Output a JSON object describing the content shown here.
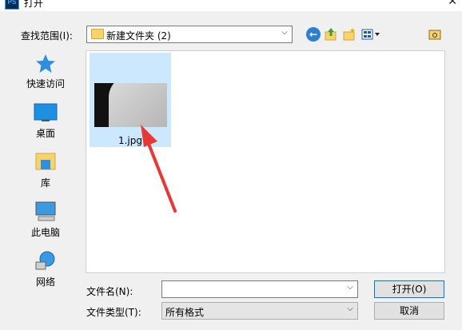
{
  "window": {
    "title": "打开",
    "app_icon": "PS"
  },
  "lookin": {
    "label": "查找范围(I):",
    "value": "新建文件夹 (2)"
  },
  "toolbar": {
    "back_icon": "back-arrow-icon",
    "up_icon": "up-folder-icon",
    "newfolder_icon": "new-folder-icon",
    "view_icon": "view-menu-icon"
  },
  "places": [
    {
      "label": "快速访问",
      "icon": "star-icon"
    },
    {
      "label": "桌面",
      "icon": "desktop-icon"
    },
    {
      "label": "库",
      "icon": "library-icon"
    },
    {
      "label": "此电脑",
      "icon": "computer-icon"
    },
    {
      "label": "网络",
      "icon": "network-icon"
    }
  ],
  "files": [
    {
      "name": "1.jpg",
      "selected": true
    }
  ],
  "filename": {
    "label": "文件名(N):",
    "value": ""
  },
  "filetype": {
    "label": "文件类型(T):",
    "value": "所有格式"
  },
  "buttons": {
    "open": "打开(O)",
    "cancel": "取消"
  },
  "colors": {
    "selection": "#cce8ff",
    "annotation_arrow": "#e53935",
    "accent": "#0078d7"
  }
}
